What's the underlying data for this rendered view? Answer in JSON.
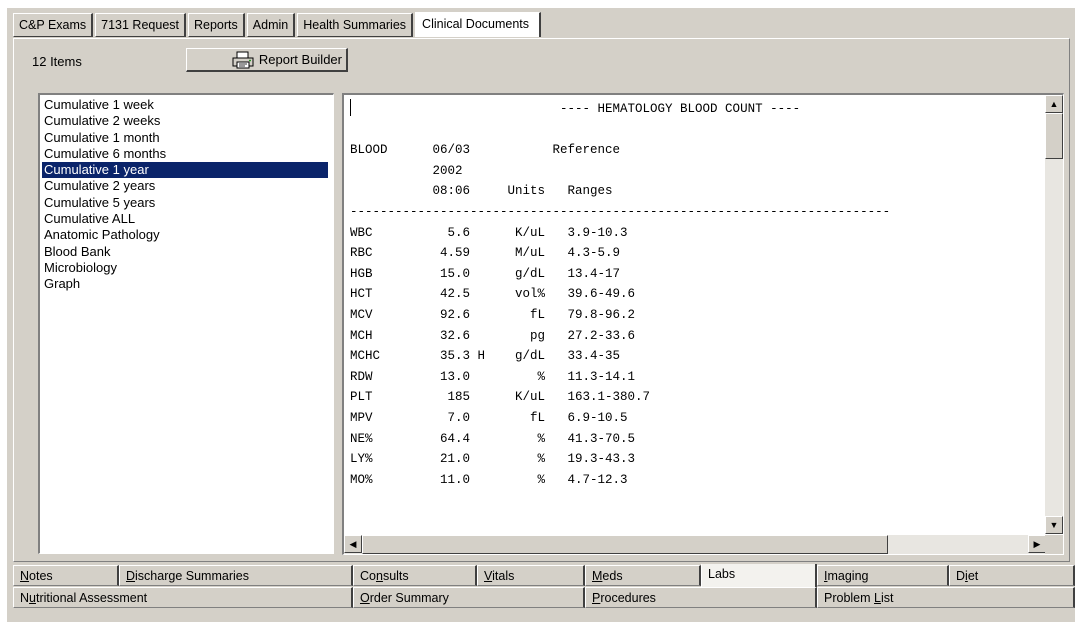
{
  "top_tabs": [
    {
      "label": "C&P Exams"
    },
    {
      "label": "7131 Request"
    },
    {
      "label": "Reports"
    },
    {
      "label": "Admin"
    },
    {
      "label": "Health Summaries"
    },
    {
      "label": "Clinical Documents"
    }
  ],
  "panel": {
    "items_count": "12 Items",
    "report_builder_label": "Report Builder"
  },
  "report_list": {
    "selected_index": 4,
    "items": [
      "Cumulative 1 week",
      "Cumulative 2 weeks",
      "Cumulative 1 month",
      "Cumulative 6 months",
      "Cumulative 1 year",
      "Cumulative 2 years",
      "Cumulative 5 years",
      "Cumulative ALL",
      "Anatomic Pathology",
      "Blood Bank",
      "Microbiology",
      "Graph"
    ]
  },
  "report": {
    "title": "---- HEMATOLOGY BLOOD COUNT ----",
    "header": {
      "col1": "BLOOD",
      "date": "06/03",
      "year": "2002",
      "time": "08:06",
      "units": "Units",
      "reference": "Reference",
      "ranges": "Ranges"
    },
    "rows": [
      {
        "test": "WBC",
        "value": "5.6",
        "flag": "",
        "units": "K/uL",
        "range": "3.9-10.3"
      },
      {
        "test": "RBC",
        "value": "4.59",
        "flag": "",
        "units": "M/uL",
        "range": "4.3-5.9"
      },
      {
        "test": "HGB",
        "value": "15.0",
        "flag": "",
        "units": "g/dL",
        "range": "13.4-17"
      },
      {
        "test": "HCT",
        "value": "42.5",
        "flag": "",
        "units": "vol%",
        "range": "39.6-49.6"
      },
      {
        "test": "MCV",
        "value": "92.6",
        "flag": "",
        "units": "fL",
        "range": "79.8-96.2"
      },
      {
        "test": "MCH",
        "value": "32.6",
        "flag": "",
        "units": "pg",
        "range": "27.2-33.6"
      },
      {
        "test": "MCHC",
        "value": "35.3",
        "flag": "H",
        "units": "g/dL",
        "range": "33.4-35"
      },
      {
        "test": "RDW",
        "value": "13.0",
        "flag": "",
        "units": "%",
        "range": "11.3-14.1"
      },
      {
        "test": "PLT",
        "value": "185",
        "flag": "",
        "units": "K/uL",
        "range": "163.1-380.7"
      },
      {
        "test": "MPV",
        "value": "7.0",
        "flag": "",
        "units": "fL",
        "range": "6.9-10.5"
      },
      {
        "test": "NE%",
        "value": "64.4",
        "flag": "",
        "units": "%",
        "range": "41.3-70.5"
      },
      {
        "test": "LY%",
        "value": "21.0",
        "flag": "",
        "units": "%",
        "range": "19.3-43.3"
      },
      {
        "test": "MO%",
        "value": "11.0",
        "flag": "",
        "units": "%",
        "range": "4.7-12.3"
      }
    ]
  },
  "bottom_tabs": {
    "row1": [
      {
        "label": "Notes",
        "mnemonic": "N"
      },
      {
        "label": "Discharge Summaries",
        "mnemonic": "D"
      },
      {
        "label": "Consults",
        "mnemonic": "n"
      },
      {
        "label": "Vitals",
        "mnemonic": "V"
      },
      {
        "label": "Meds",
        "mnemonic": "M"
      },
      {
        "label": "Labs",
        "mnemonic": ""
      },
      {
        "label": "Imaging",
        "mnemonic": "I"
      },
      {
        "label": "Diet",
        "mnemonic": "i"
      }
    ],
    "row2": [
      {
        "label": "Nutritional Assessment",
        "mnemonic": "u"
      },
      {
        "label": "Order Summary",
        "mnemonic": "O"
      },
      {
        "label": "Procedures",
        "mnemonic": "P"
      },
      {
        "label": "Problem List",
        "mnemonic": "L"
      }
    ],
    "active": "Labs"
  }
}
